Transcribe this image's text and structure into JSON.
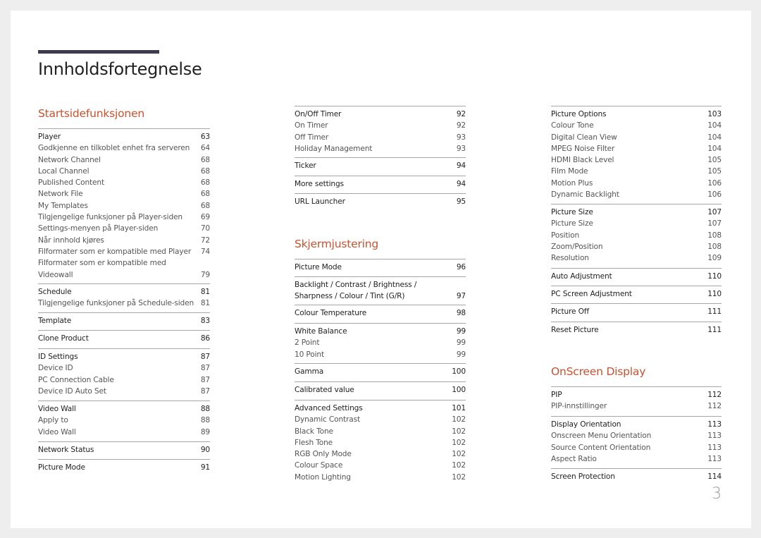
{
  "document": {
    "title": "Innholdsfortegnelse",
    "page_number": "3",
    "accent_color": "#c9522f",
    "title_bar_color": "#3c3c4e"
  },
  "columns": [
    {
      "sections": [
        {
          "title": "Startsidefunksjonen",
          "groups": [
            {
              "items": [
                {
                  "label": "Player",
                  "page": "63",
                  "level": "head"
                },
                {
                  "label": "Godkjenne en tilkoblet enhet fra serveren",
                  "page": "64",
                  "level": "sub"
                },
                {
                  "label": "Network Channel",
                  "page": "68",
                  "level": "sub"
                },
                {
                  "label": "Local Channel",
                  "page": "68",
                  "level": "sub"
                },
                {
                  "label": "Published Content",
                  "page": "68",
                  "level": "sub"
                },
                {
                  "label": "Network File",
                  "page": "68",
                  "level": "sub"
                },
                {
                  "label": "My Templates",
                  "page": "68",
                  "level": "sub"
                },
                {
                  "label": "Tilgjengelige funksjoner på Player-siden",
                  "page": "69",
                  "level": "sub"
                },
                {
                  "label": "Settings-menyen på Player-siden",
                  "page": "70",
                  "level": "sub"
                },
                {
                  "label": "Når innhold kjøres",
                  "page": "72",
                  "level": "sub"
                },
                {
                  "label": "Filformater som er kompatible med Player",
                  "page": "74",
                  "level": "sub"
                },
                {
                  "label": "Filformater som er kompatible med Videowall",
                  "page": "79",
                  "level": "sub"
                }
              ]
            },
            {
              "items": [
                {
                  "label": "Schedule",
                  "page": "81",
                  "level": "head"
                },
                {
                  "label": "Tilgjengelige funksjoner på Schedule-siden",
                  "page": "81",
                  "level": "sub"
                }
              ]
            },
            {
              "items": [
                {
                  "label": "Template",
                  "page": "83",
                  "level": "head"
                }
              ]
            },
            {
              "items": [
                {
                  "label": "Clone Product",
                  "page": "86",
                  "level": "head"
                }
              ]
            },
            {
              "items": [
                {
                  "label": "ID Settings",
                  "page": "87",
                  "level": "head"
                },
                {
                  "label": "Device ID",
                  "page": "87",
                  "level": "sub"
                },
                {
                  "label": "PC Connection Cable",
                  "page": "87",
                  "level": "sub"
                },
                {
                  "label": "Device ID Auto Set",
                  "page": "87",
                  "level": "sub"
                }
              ]
            },
            {
              "items": [
                {
                  "label": "Video Wall",
                  "page": "88",
                  "level": "head"
                },
                {
                  "label": "Apply to",
                  "page": "88",
                  "level": "sub"
                },
                {
                  "label": "Video Wall",
                  "page": "89",
                  "level": "sub"
                }
              ]
            },
            {
              "items": [
                {
                  "label": "Network Status",
                  "page": "90",
                  "level": "head"
                }
              ]
            },
            {
              "items": [
                {
                  "label": "Picture Mode",
                  "page": "91",
                  "level": "head"
                }
              ]
            }
          ]
        }
      ]
    },
    {
      "sections": [
        {
          "title": "",
          "groups": [
            {
              "items": [
                {
                  "label": "On/Off Timer",
                  "page": "92",
                  "level": "head"
                },
                {
                  "label": "On Timer",
                  "page": "92",
                  "level": "sub"
                },
                {
                  "label": "Off Timer",
                  "page": "93",
                  "level": "sub"
                },
                {
                  "label": "Holiday Management",
                  "page": "93",
                  "level": "sub"
                }
              ]
            },
            {
              "items": [
                {
                  "label": "Ticker",
                  "page": "94",
                  "level": "head"
                }
              ]
            },
            {
              "items": [
                {
                  "label": "More settings",
                  "page": "94",
                  "level": "head"
                }
              ]
            },
            {
              "items": [
                {
                  "label": "URL Launcher",
                  "page": "95",
                  "level": "head"
                }
              ]
            }
          ]
        },
        {
          "title": "Skjermjustering",
          "groups": [
            {
              "items": [
                {
                  "label": "Picture Mode",
                  "page": "96",
                  "level": "head"
                }
              ]
            },
            {
              "items": [
                {
                  "label": "Backlight / Contrast / Brightness / Sharpness / Colour / Tint (G/R)",
                  "page": "97",
                  "level": "head"
                }
              ]
            },
            {
              "items": [
                {
                  "label": "Colour Temperature",
                  "page": "98",
                  "level": "head"
                }
              ]
            },
            {
              "items": [
                {
                  "label": "White Balance",
                  "page": "99",
                  "level": "head"
                },
                {
                  "label": "2 Point",
                  "page": "99",
                  "level": "sub"
                },
                {
                  "label": "10 Point",
                  "page": "99",
                  "level": "sub"
                }
              ]
            },
            {
              "items": [
                {
                  "label": "Gamma",
                  "page": "100",
                  "level": "head"
                }
              ]
            },
            {
              "items": [
                {
                  "label": "Calibrated value",
                  "page": "100",
                  "level": "head"
                }
              ]
            },
            {
              "items": [
                {
                  "label": "Advanced Settings",
                  "page": "101",
                  "level": "head"
                },
                {
                  "label": "Dynamic Contrast",
                  "page": "102",
                  "level": "sub"
                },
                {
                  "label": "Black Tone",
                  "page": "102",
                  "level": "sub"
                },
                {
                  "label": "Flesh Tone",
                  "page": "102",
                  "level": "sub"
                },
                {
                  "label": "RGB Only Mode",
                  "page": "102",
                  "level": "sub"
                },
                {
                  "label": "Colour Space",
                  "page": "102",
                  "level": "sub"
                },
                {
                  "label": "Motion Lighting",
                  "page": "102",
                  "level": "sub"
                }
              ]
            }
          ]
        }
      ]
    },
    {
      "sections": [
        {
          "title": "",
          "groups": [
            {
              "items": [
                {
                  "label": "Picture Options",
                  "page": "103",
                  "level": "head"
                },
                {
                  "label": "Colour Tone",
                  "page": "104",
                  "level": "sub"
                },
                {
                  "label": "Digital Clean View",
                  "page": "104",
                  "level": "sub"
                },
                {
                  "label": "MPEG Noise Filter",
                  "page": "104",
                  "level": "sub"
                },
                {
                  "label": "HDMI Black Level",
                  "page": "105",
                  "level": "sub"
                },
                {
                  "label": "Film Mode",
                  "page": "105",
                  "level": "sub"
                },
                {
                  "label": "Motion Plus",
                  "page": "106",
                  "level": "sub"
                },
                {
                  "label": "Dynamic Backlight",
                  "page": "106",
                  "level": "sub"
                }
              ]
            },
            {
              "items": [
                {
                  "label": "Picture Size",
                  "page": "107",
                  "level": "head"
                },
                {
                  "label": "Picture Size",
                  "page": "107",
                  "level": "sub"
                },
                {
                  "label": "Position",
                  "page": "108",
                  "level": "sub"
                },
                {
                  "label": "Zoom/Position",
                  "page": "108",
                  "level": "sub"
                },
                {
                  "label": "Resolution",
                  "page": "109",
                  "level": "sub"
                }
              ]
            },
            {
              "items": [
                {
                  "label": "Auto Adjustment",
                  "page": "110",
                  "level": "head"
                }
              ]
            },
            {
              "items": [
                {
                  "label": "PC Screen Adjustment",
                  "page": "110",
                  "level": "head"
                }
              ]
            },
            {
              "items": [
                {
                  "label": "Picture Off",
                  "page": "111",
                  "level": "head"
                }
              ]
            },
            {
              "items": [
                {
                  "label": "Reset Picture",
                  "page": "111",
                  "level": "head"
                }
              ]
            }
          ]
        },
        {
          "title": "OnScreen Display",
          "groups": [
            {
              "items": [
                {
                  "label": "PIP",
                  "page": "112",
                  "level": "head"
                },
                {
                  "label": "PIP-innstillinger",
                  "page": "112",
                  "level": "sub"
                }
              ]
            },
            {
              "items": [
                {
                  "label": "Display Orientation",
                  "page": "113",
                  "level": "head"
                },
                {
                  "label": "Onscreen Menu Orientation",
                  "page": "113",
                  "level": "sub"
                },
                {
                  "label": "Source Content Orientation",
                  "page": "113",
                  "level": "sub"
                },
                {
                  "label": "Aspect Ratio",
                  "page": "113",
                  "level": "sub"
                }
              ]
            },
            {
              "items": [
                {
                  "label": "Screen Protection",
                  "page": "114",
                  "level": "head"
                }
              ]
            }
          ]
        }
      ]
    }
  ]
}
